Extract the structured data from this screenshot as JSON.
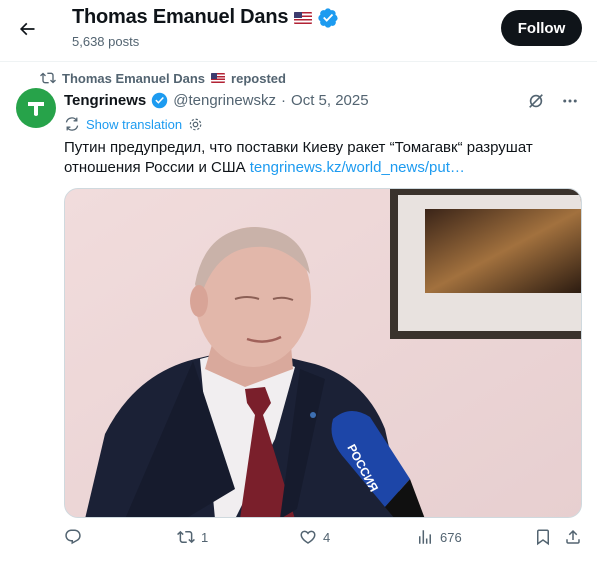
{
  "header": {
    "name": "Thomas Emanuel Dans",
    "post_count": "5,638 posts",
    "follow_label": "Follow"
  },
  "repost": {
    "text": "Thomas Emanuel Dans",
    "suffix": "reposted"
  },
  "tweet": {
    "author_name": "Tengrinews",
    "handle": "@tengrinewskz",
    "separator": "·",
    "date": "Oct 5, 2025",
    "show_translation": "Show translation",
    "text": "Путин предупредил, что поставки Киеву ракет “Томагавк“ разрушат отношения России и США",
    "link_text": "tengrinews.kz/world_news/put…",
    "media_description_icon": "video-still"
  },
  "actions": {
    "replies": "",
    "reposts": "1",
    "likes": "4",
    "views": "676"
  },
  "colors": {
    "accent": "#1d9bf0",
    "verified": "#1d9bf0",
    "avatar_bg": "#27a34a",
    "follow_bg": "#0f1419",
    "muted_text": "#536471"
  }
}
